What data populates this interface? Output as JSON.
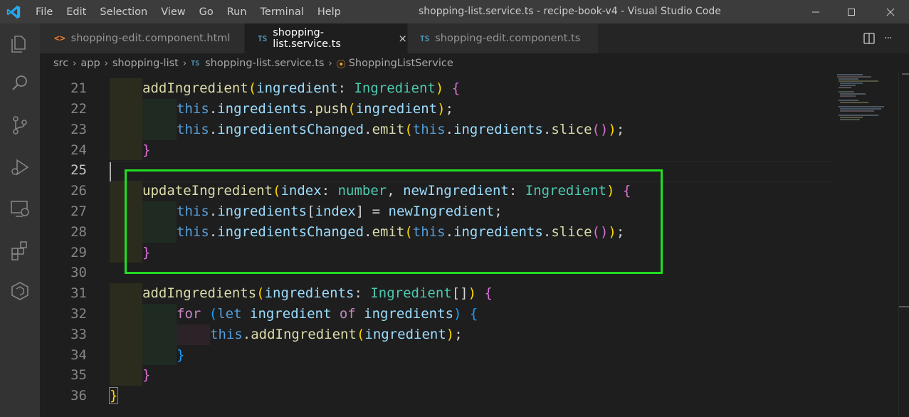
{
  "app": {
    "window_title": "shopping-list.service.ts - recipe-book-v4 - Visual Studio Code",
    "menu": [
      "File",
      "Edit",
      "Selection",
      "View",
      "Go",
      "Run",
      "Terminal",
      "Help"
    ]
  },
  "activity_bar": {
    "icons": [
      "explorer-icon",
      "search-icon",
      "source-control-icon",
      "run-debug-icon",
      "remote-explorer-icon",
      "extensions-icon",
      "angular-icon"
    ]
  },
  "tabs": [
    {
      "label": "shopping-edit.component.html",
      "icon": "<>",
      "active": false
    },
    {
      "label": "shopping-list.service.ts",
      "icon": "TS",
      "active": true,
      "close": "×"
    },
    {
      "label": "shopping-edit.component.ts",
      "icon": "TS",
      "active": false
    }
  ],
  "tab_actions": {
    "split_icon": "split-editor-icon",
    "more": "···"
  },
  "breadcrumb": {
    "items": [
      "src",
      "app",
      "shopping-list",
      "shopping-list.service.ts",
      "ShoppingListService"
    ],
    "file_icon": "TS"
  },
  "editor": {
    "line_numbers": [
      "21",
      "22",
      "23",
      "24",
      "25",
      "26",
      "27",
      "28",
      "29",
      "30",
      "31",
      "32",
      "33",
      "34",
      "35",
      "36"
    ],
    "current_line": "25",
    "colors": {
      "highlight_box": "#22dd22",
      "keyword": "#c586c0",
      "function": "#dcdcaa",
      "variable": "#9cdcfe",
      "type": "#4ec9b0"
    },
    "code": {
      "l21": {
        "fn": "addIngredient",
        "p1": "(",
        "param": "ingredient",
        "colon": ": ",
        "type": "Ingredient",
        "p2": ")",
        "brace": " {"
      },
      "l22": {
        "this": "this",
        "dot1": ".",
        "prop": "ingredients",
        "dot2": ".",
        "fn": "push",
        "p1": "(",
        "arg": "ingredient",
        "p2": ")",
        "semi": ";"
      },
      "l23": {
        "this": "this",
        "dot1": ".",
        "prop": "ingredientsChanged",
        "dot2": ".",
        "fn": "emit",
        "p1": "(",
        "this2": "this",
        "dot3": ".",
        "prop2": "ingredients",
        "dot4": ".",
        "fn2": "slice",
        "p2": "(",
        "p3": ")",
        "p4": ")",
        "semi": ";"
      },
      "l24": {
        "brace": "}"
      },
      "l26": {
        "fn": "updateIngredient",
        "p1": "(",
        "param1": "index",
        "colon1": ": ",
        "type1": "number",
        "comma": ", ",
        "param2": "newIngredient",
        "colon2": ": ",
        "type2": "Ingredient",
        "p2": ")",
        "brace": " {"
      },
      "l27": {
        "this": "this",
        "dot1": ".",
        "prop": "ingredients",
        "b1": "[",
        "idx": "index",
        "b2": "]",
        "eq": " = ",
        "val": "newIngredient",
        "semi": ";"
      },
      "l28": {
        "this": "this",
        "dot1": ".",
        "prop": "ingredientsChanged",
        "dot2": ".",
        "fn": "emit",
        "p1": "(",
        "this2": "this",
        "dot3": ".",
        "prop2": "ingredients",
        "dot4": ".",
        "fn2": "slice",
        "p2": "(",
        "p3": ")",
        "p4": ")",
        "semi": ";"
      },
      "l29": {
        "brace": "}"
      },
      "l31": {
        "fn": "addIngredients",
        "p1": "(",
        "param": "ingredients",
        "colon": ": ",
        "type": "Ingredient",
        "arr": "[]",
        "p2": ")",
        "brace": " {"
      },
      "l32": {
        "kw": "for",
        "sp": " ",
        "p1": "(",
        "let": "let",
        "v1": " ingredient ",
        "of": "of",
        "v2": " ingredients",
        "p2": ")",
        "brace": " {"
      },
      "l33": {
        "this": "this",
        "dot1": ".",
        "fn": "addIngredient",
        "p1": "(",
        "arg": "ingredient",
        "p2": ")",
        "semi": ";"
      },
      "l34": {
        "brace": "}"
      },
      "l35": {
        "brace": "}"
      },
      "l36": {
        "brace": "}"
      }
    }
  }
}
